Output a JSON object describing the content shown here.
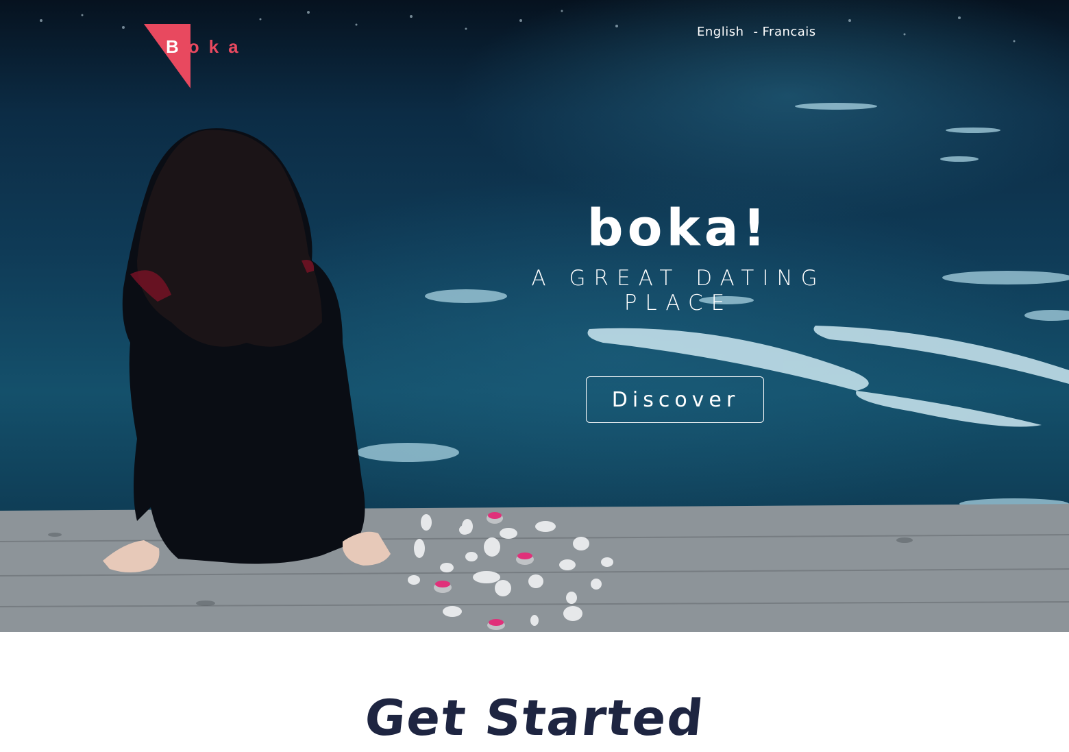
{
  "logo": {
    "text_first": "B",
    "text_rest": "oka",
    "accent_color": "#e8495f"
  },
  "language": {
    "english": "English",
    "separator": "-",
    "french": "Francais"
  },
  "hero": {
    "brand": "boka!",
    "tagline": "A GREAT DATING PLACE",
    "cta_label": "Discover"
  },
  "section": {
    "title": "Get Started"
  },
  "colors": {
    "heading": "#1e2541",
    "water": "#14506b",
    "dock": "#8a9196"
  }
}
